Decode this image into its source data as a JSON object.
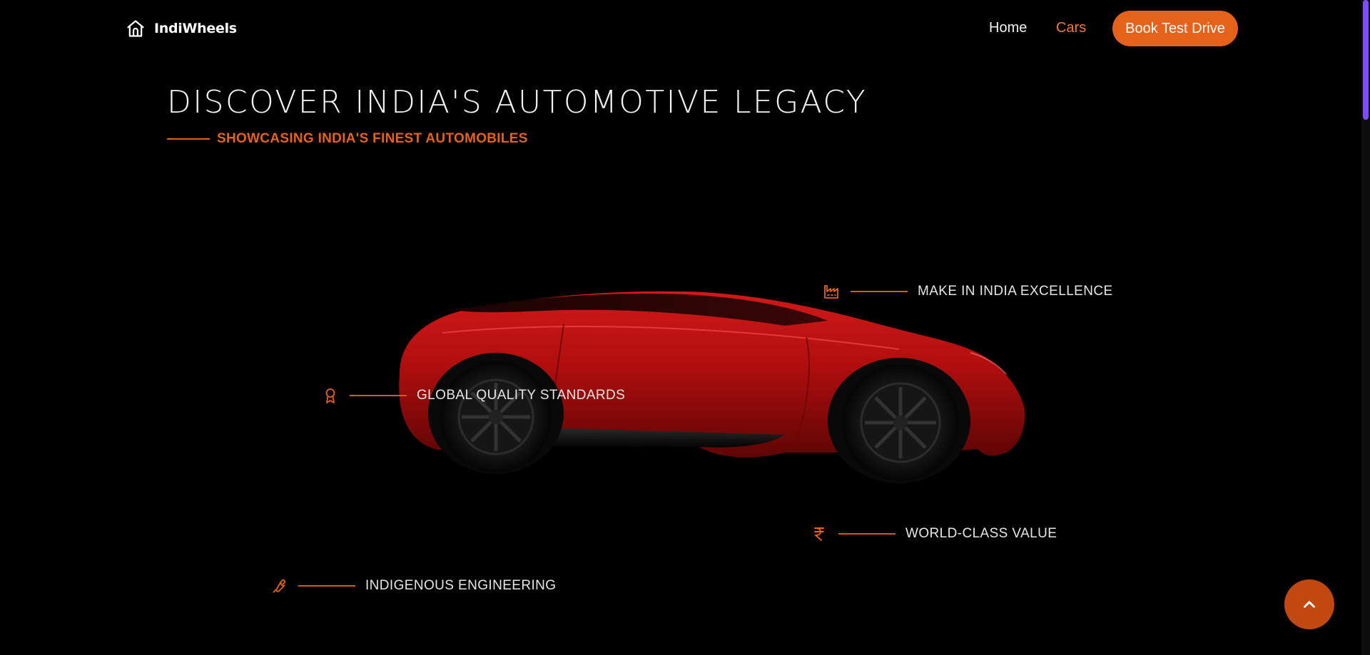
{
  "nav": {
    "logo_icon": "home-icon",
    "brand": "IndiWheels",
    "links": [
      {
        "label": "Home",
        "active": false
      },
      {
        "label": "Cars",
        "active": true
      }
    ],
    "cta_label": "Book Test Drive"
  },
  "hero": {
    "title": "DISCOVER INDIA'S AUTOMOTIVE LEGACY",
    "subtitle": "SHOWCASING INDIA'S FINEST AUTOMOBILES"
  },
  "features": [
    {
      "icon": "factory-icon",
      "label": "MAKE IN INDIA EXCELLENCE"
    },
    {
      "icon": "award-icon",
      "label": "GLOBAL QUALITY STANDARDS"
    },
    {
      "icon": "rupee-icon",
      "label": "WORLD-CLASS VALUE"
    },
    {
      "icon": "wrench-icon",
      "label": "INDIGENOUS ENGINEERING"
    }
  ],
  "scroll_top": {
    "icon": "chevron-up-icon"
  },
  "colors": {
    "accent": "#e5621b",
    "accent_dark": "#c24811",
    "active_link": "#f07a32",
    "background": "#000000",
    "car_red": "#b30f0f",
    "scrollbar_thumb": "#7c4dff"
  }
}
